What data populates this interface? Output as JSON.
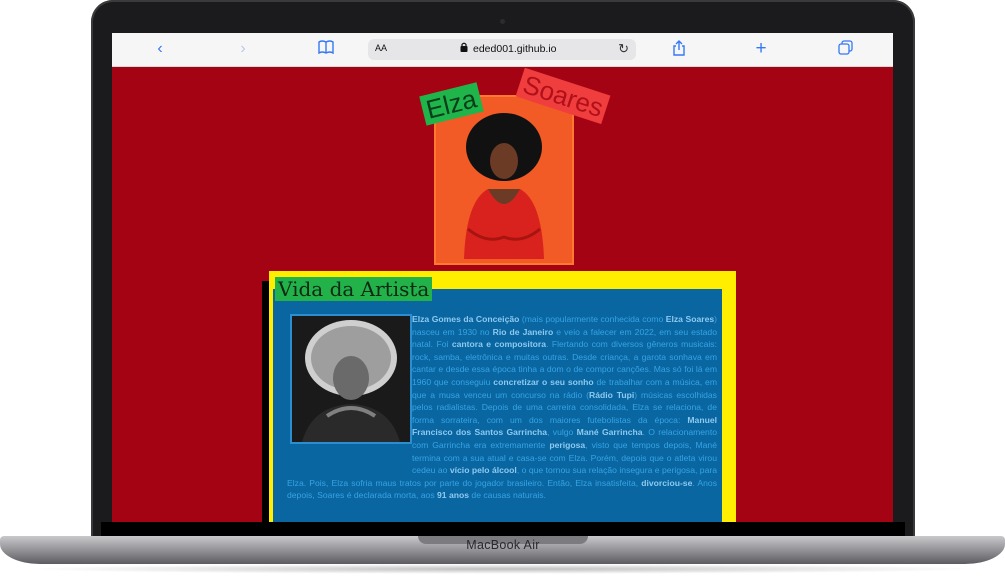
{
  "browser": {
    "address_bar": {
      "text_size_label": "AA",
      "url": "eded001.github.io"
    }
  },
  "device": {
    "brand": "MacBook Air"
  },
  "page": {
    "hero": {
      "title_left": "Elza",
      "title_right": "Soares"
    },
    "bio": {
      "heading": "Vida da Artista",
      "paragraphs": [
        [
          "b",
          "Elza Gomes da Conceição"
        ],
        [
          "t",
          " (mais popularmente conhecida como "
        ],
        [
          "b",
          "Elza Soares"
        ],
        [
          "t",
          ") nasceu em 1930 no "
        ],
        [
          "b",
          "Rio de Janeiro"
        ],
        [
          "t",
          " e veio a falecer em 2022, em seu estado natal. Foi "
        ],
        [
          "b",
          "cantora e compositora"
        ],
        [
          "t",
          ". Flertando com diversos gêneros musicais: rock, samba, eletrônica e muitas outras. Desde criança, a garota sonhava em cantar e desde essa época tinha a dom o de compor canções. Mas só foi lá em 1960 que conseguiu "
        ],
        [
          "b",
          "concretizar o seu sonho"
        ],
        [
          "t",
          " de trabalhar com a música, em que a musa venceu um concurso na rádio ("
        ],
        [
          "b",
          "Rádio Tupi"
        ],
        [
          "t",
          ") músicas escolhidas pelos radialistas. Depois de uma carreira consolidada, Elza se relaciona, de forma sorrateira, com um dos maiores futebolistas da época: "
        ],
        [
          "b",
          "Manuel Francisco dos Santos Garrincha"
        ],
        [
          "t",
          ", vulgo "
        ],
        [
          "b",
          "Mané Garrincha"
        ],
        [
          "t",
          ". O relacionamento com Garrincha era extremamente "
        ],
        [
          "b",
          "perigosa"
        ],
        [
          "t",
          ", visto que tempos depois, Mané termina com a sua atual e casa-se com Elza. Porém, depois que o atleta virou cedeu ao "
        ],
        [
          "b",
          "vício pelo álcool"
        ],
        [
          "t",
          ", o que tornou sua relação insegura e perigosa, para Elza. Pois, Elza sofria maus tratos por parte do jogador brasileiro. Então, Elza insatisfeita, "
        ],
        [
          "b",
          "divorciou-se"
        ],
        [
          "t",
          ". Anos depois, Soares é declarada morta, aos "
        ],
        [
          "b",
          "91 anos"
        ],
        [
          "t",
          " de causas naturais."
        ]
      ]
    }
  },
  "colors": {
    "page_bg": "#a40314",
    "hero_bg": "#f25a26",
    "bio_frame": "#ffee00",
    "bio_bg": "#0a66a0",
    "heading_bg": "#23b24a",
    "link_blue": "#3478f6"
  },
  "icons": [
    "back-icon",
    "forward-icon",
    "bookmarks-icon",
    "lock-icon",
    "reload-icon",
    "share-icon",
    "new-tab-icon",
    "tabs-icon"
  ]
}
